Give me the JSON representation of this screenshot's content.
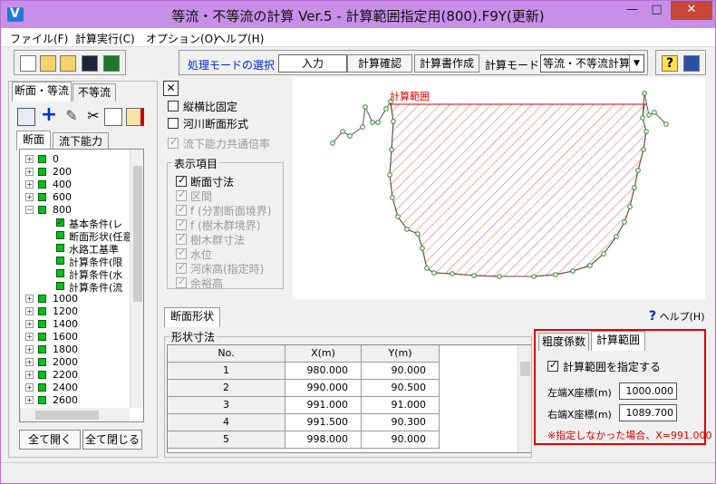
{
  "window": {
    "title": "等流・不等流の計算 Ver.5 - 計算範囲指定用(800).F9Y(更新)",
    "controls": [
      "—",
      "□",
      "✕"
    ]
  },
  "menu": [
    "ファイル(F)",
    "計算実行(C)",
    "オプション(O)",
    "ヘルプ(H)"
  ],
  "toolbar": {
    "mode_label": "処理モードの選択",
    "buttons": [
      "入力",
      "計算確認",
      "計算書作成"
    ],
    "calc_mode_label": "計算モード",
    "calc_mode_value": "等流・不等流計算"
  },
  "left_tabs": [
    "断面・等流",
    "不等流"
  ],
  "sub_tabs": [
    "断面",
    "流下能力"
  ],
  "tree": [
    {
      "label": "0",
      "level": 0,
      "expander": "+"
    },
    {
      "label": "200",
      "level": 0,
      "expander": "+"
    },
    {
      "label": "400",
      "level": 0,
      "expander": "+"
    },
    {
      "label": "600",
      "level": 0,
      "expander": "+"
    },
    {
      "label": "800",
      "level": 0,
      "expander": "−"
    },
    {
      "label": "基本条件(レ",
      "level": 1,
      "checked": true
    },
    {
      "label": "断面形状(任意",
      "level": 1
    },
    {
      "label": "水路工基準",
      "level": 1
    },
    {
      "label": "計算条件(限",
      "level": 1
    },
    {
      "label": "計算条件(水",
      "level": 1
    },
    {
      "label": "計算条件(流",
      "level": 1
    },
    {
      "label": "1000",
      "level": 0,
      "expander": "+"
    },
    {
      "label": "1200",
      "level": 0,
      "expander": "+"
    },
    {
      "label": "1400",
      "level": 0,
      "expander": "+"
    },
    {
      "label": "1600",
      "level": 0,
      "expander": "+"
    },
    {
      "label": "1800",
      "level": 0,
      "expander": "+"
    },
    {
      "label": "2000",
      "level": 0,
      "expander": "+"
    },
    {
      "label": "2200",
      "level": 0,
      "expander": "+"
    },
    {
      "label": "2400",
      "level": 0,
      "expander": "+"
    },
    {
      "label": "2600",
      "level": 0,
      "expander": "+"
    }
  ],
  "left_buttons": {
    "expand_all": "全て開く",
    "collapse_all": "全て閉じる"
  },
  "options": {
    "aspect_fixed": "縦横比固定",
    "river_section": "河川断面形式",
    "common_ratio": "流下能力共通倍率",
    "display_group": "表示項目",
    "display_items": [
      {
        "label": "断面寸法",
        "checked": true,
        "enabled": true
      },
      {
        "label": "区間",
        "checked": true,
        "enabled": false
      },
      {
        "label": "f (分割断面境界)",
        "checked": true,
        "enabled": false
      },
      {
        "label": "f (樹木群境界)",
        "checked": true,
        "enabled": false
      },
      {
        "label": "樹木群寸法",
        "checked": true,
        "enabled": false
      },
      {
        "label": "水位",
        "checked": true,
        "enabled": false
      },
      {
        "label": "河床高(指定時)",
        "checked": true,
        "enabled": false
      },
      {
        "label": "余裕高",
        "checked": true,
        "enabled": false
      }
    ]
  },
  "drawing": {
    "calc_range_label": "計算範囲",
    "range_color": "#e00000"
  },
  "section_tab": "断面形状",
  "help_label": "ヘルプ(H)",
  "shape_group": "形状寸法",
  "table": {
    "headers": [
      "No.",
      "X(m)",
      "Y(m)"
    ],
    "rows": [
      [
        "1",
        "980.000",
        "90.000"
      ],
      [
        "2",
        "990.000",
        "90.500"
      ],
      [
        "3",
        "991.000",
        "91.000"
      ],
      [
        "4",
        "991.500",
        "90.300"
      ],
      [
        "5",
        "998.000",
        "90.000"
      ]
    ]
  },
  "range_panel": {
    "tabs": [
      "粗度係数",
      "計算範囲"
    ],
    "enable_label": "計算範囲を指定する",
    "left_label": "左端X座標(m)",
    "left_value": "1000.000",
    "right_label": "右端X座標(m)",
    "right_value": "1089.700",
    "note": "※指定しなかった場合、X=991.000"
  }
}
